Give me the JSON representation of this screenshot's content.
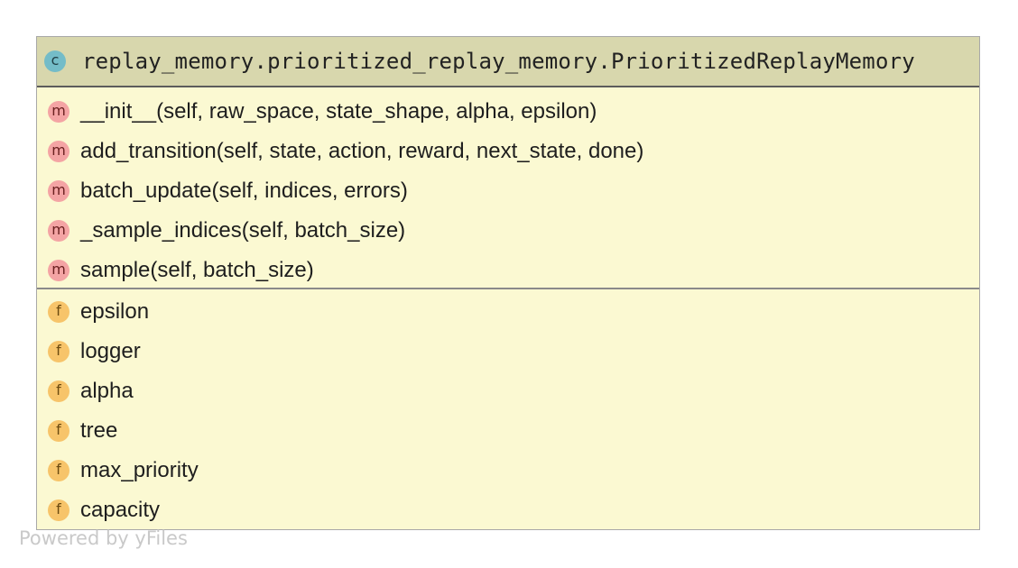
{
  "class_node": {
    "badge": "c",
    "title": "replay_memory.prioritized_replay_memory.PrioritizedReplayMemory"
  },
  "methods": [
    {
      "badge": "m",
      "label": "__init__(self, raw_space, state_shape, alpha, epsilon)"
    },
    {
      "badge": "m",
      "label": "add_transition(self, state, action, reward, next_state, done)"
    },
    {
      "badge": "m",
      "label": "batch_update(self, indices, errors)"
    },
    {
      "badge": "m",
      "label": "_sample_indices(self, batch_size)"
    },
    {
      "badge": "m",
      "label": "sample(self, batch_size)"
    }
  ],
  "fields": [
    {
      "badge": "f",
      "label": "epsilon"
    },
    {
      "badge": "f",
      "label": "logger"
    },
    {
      "badge": "f",
      "label": "alpha"
    },
    {
      "badge": "f",
      "label": "tree"
    },
    {
      "badge": "f",
      "label": "max_priority"
    },
    {
      "badge": "f",
      "label": "capacity"
    }
  ],
  "watermark": "Powered by yFiles",
  "colors": {
    "header_background": "#d8d7ad",
    "body_background": "#fbf9d2",
    "class_badge": "#74bcc8",
    "method_badge": "#f4a4a4",
    "field_badge": "#f7c46a"
  }
}
